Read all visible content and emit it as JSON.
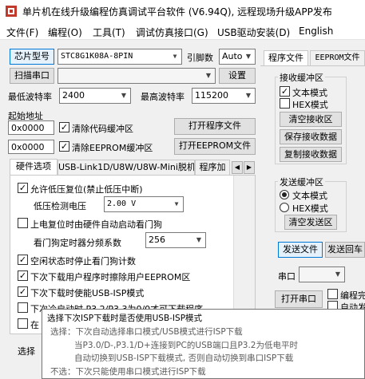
{
  "window": {
    "title": "单片机在线升级编程仿真调试平台软件 (V6.94Q), 远程现场升级APP发布",
    "menu": [
      "文件(F)",
      "编程(O)",
      "工具(T)",
      "调试仿真接口(G)",
      "USB驱动安装(D)",
      "English"
    ]
  },
  "chip": {
    "button_label": "芯片型号",
    "model": "STC8G1K08A-8PIN",
    "pins_label": "引脚数",
    "pins_value": "Auto"
  },
  "port": {
    "scan_button": "扫描串口",
    "port_value": "",
    "settings_button": "设置"
  },
  "baud": {
    "min_label": "最低波特率",
    "min_value": "2400",
    "max_label": "最高波特率",
    "max_value": "115200"
  },
  "address": {
    "label": "起始地址",
    "code_addr": "0x0000",
    "clear_code_label": "清除代码缓冲区",
    "open_program_button": "打开程序文件",
    "eeprom_addr": "0x0000",
    "clear_eeprom_label": "清除EEPROM缓冲区",
    "open_eeprom_button": "打开EEPROM文件"
  },
  "tabs": [
    "硬件选项",
    "USB-Link1D/U8W/U8W-Mini脱机",
    "程序加"
  ],
  "options": {
    "low_voltage_reset": "允许低压复位(禁止低压中断)",
    "low_voltage_label": "低压检测电压",
    "low_voltage_value": "2.00 V",
    "watchdog_auto": "上电复位时由硬件自动启动看门狗",
    "watchdog_prescale_label": "看门狗定时器分频系数",
    "watchdog_prescale_value": "256",
    "idle_stop_watchdog": "空闲状态时停止看门狗计数",
    "erase_user_eeprom": "下次下载用户程序时擦除用户EEPROM区",
    "next_usb_isp": "下次下载时使能USB-ISP模式",
    "next_cold_start_partial": "下次冷启动时 P3.2/P3.3为0/0才可下载程序",
    "row_partial": "在",
    "row_partial_2": "选择",
    "option_checked": "✓"
  },
  "right_tabs": [
    "程序文件",
    "EEPROM文件"
  ],
  "receive": {
    "group_title": "接收缓冲区",
    "text_mode": "文本模式",
    "hex_mode": "HEX模式",
    "clear_button": "清空接收区",
    "save_button": "保存接收数据",
    "copy_button": "复制接收数据"
  },
  "send": {
    "group_title": "发送缓冲区",
    "text_mode": "文本模式",
    "hex_mode": "HEX模式",
    "clear_button": "清空发送区",
    "send_file_button": "发送文件",
    "send_return_button": "发送回车"
  },
  "serial": {
    "port_label": "串口",
    "open_button": "打开串口",
    "edit_label": "编程完",
    "auto_label": "自动发"
  },
  "tooltip": {
    "line1": "选择下次ISP下载时是否使用USB-ISP模式",
    "line2": "选择：下次自动选择串口模式/USB模式进行ISP下载",
    "line3": "当P3.0/D-,P3.1/D+连接到PC的USB端口且P3.2为低电平时",
    "line4": "自动切换到USB-ISP下载模式, 否则自动切换到串口ISP下载",
    "line5": "不选：下次只能使用串口模式进行ISP下载"
  },
  "colors": {
    "accent_blue": "#0078d7",
    "checkbox_mark": "#000000",
    "tooltip_border": "#767676"
  }
}
